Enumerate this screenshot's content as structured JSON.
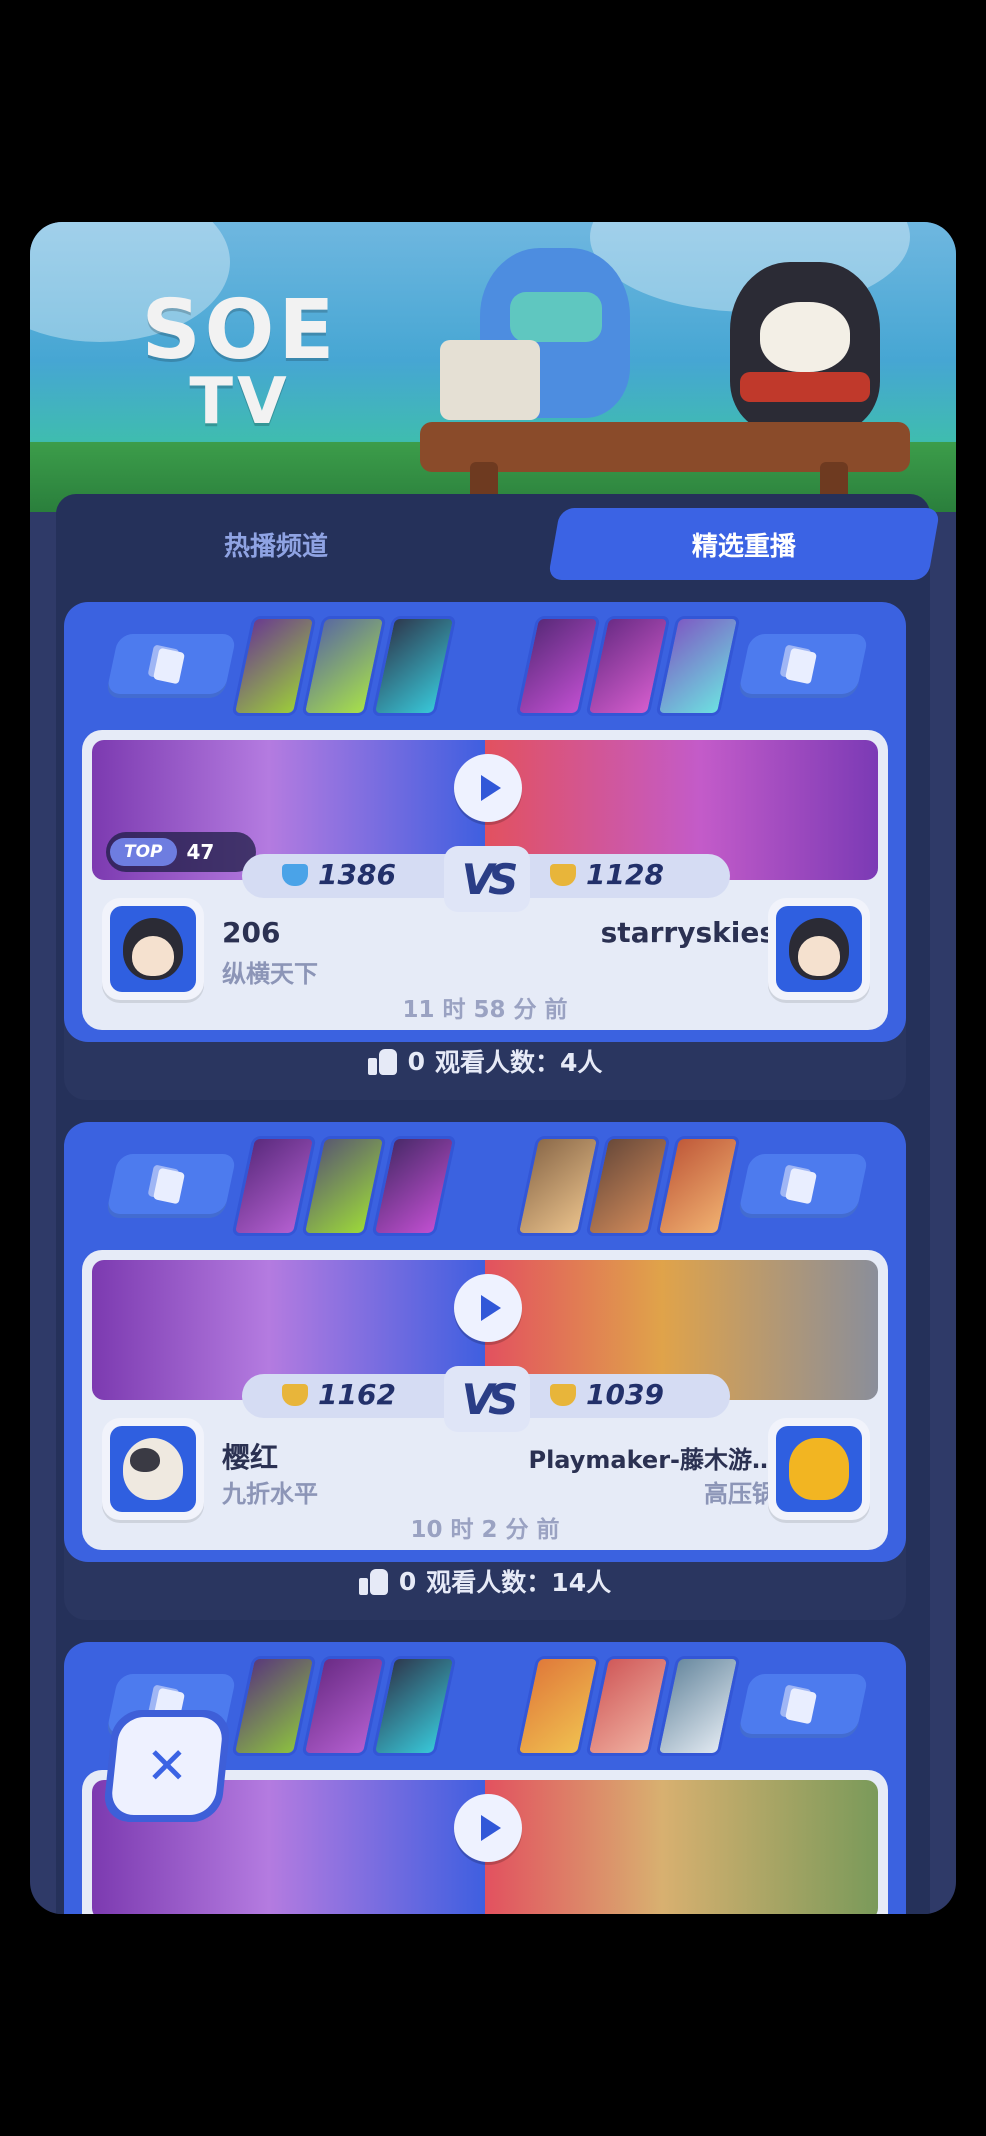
{
  "banner": {
    "logo_line1": "SOE",
    "logo_line2": "TV"
  },
  "tabs": [
    {
      "label": "热播频道",
      "active": false
    },
    {
      "label": "精选重播",
      "active": true
    }
  ],
  "matches": [
    {
      "top_badge": {
        "label": "TOP",
        "value": "47"
      },
      "left": {
        "name": "206",
        "subtitle": "纵横天下",
        "score": "1386",
        "rank_color": "#4aa3e8"
      },
      "right": {
        "name": "starryskies",
        "subtitle": "",
        "score": "1128",
        "rank_color": "#e8b53a"
      },
      "time": "11 时 58 分 前",
      "footer": {
        "likes": "0",
        "viewers_label": "观看人数：4人"
      }
    },
    {
      "top_badge": null,
      "left": {
        "name": "樱红",
        "subtitle": "九折水平",
        "score": "1162",
        "rank_color": "#e8b53a"
      },
      "right": {
        "name": "Playmaker-藤木游…",
        "subtitle": "高压锅",
        "score": "1039",
        "rank_color": "#e8b53a"
      },
      "time": "10 时 2 分 前",
      "footer": {
        "likes": "0",
        "viewers_label": "观看人数：14人"
      }
    },
    {
      "top_badge": null
    }
  ],
  "vs_label": "VS",
  "colors": {
    "accent": "#3b63e4",
    "panel": "#2f3a68",
    "card_blue": "#3b62e0",
    "red_side": "#e2515f"
  },
  "icons": {
    "close": "close-icon",
    "like": "thumbs-up-icon",
    "play": "play-icon",
    "cards": "cards-icon"
  },
  "close_label": "✕"
}
